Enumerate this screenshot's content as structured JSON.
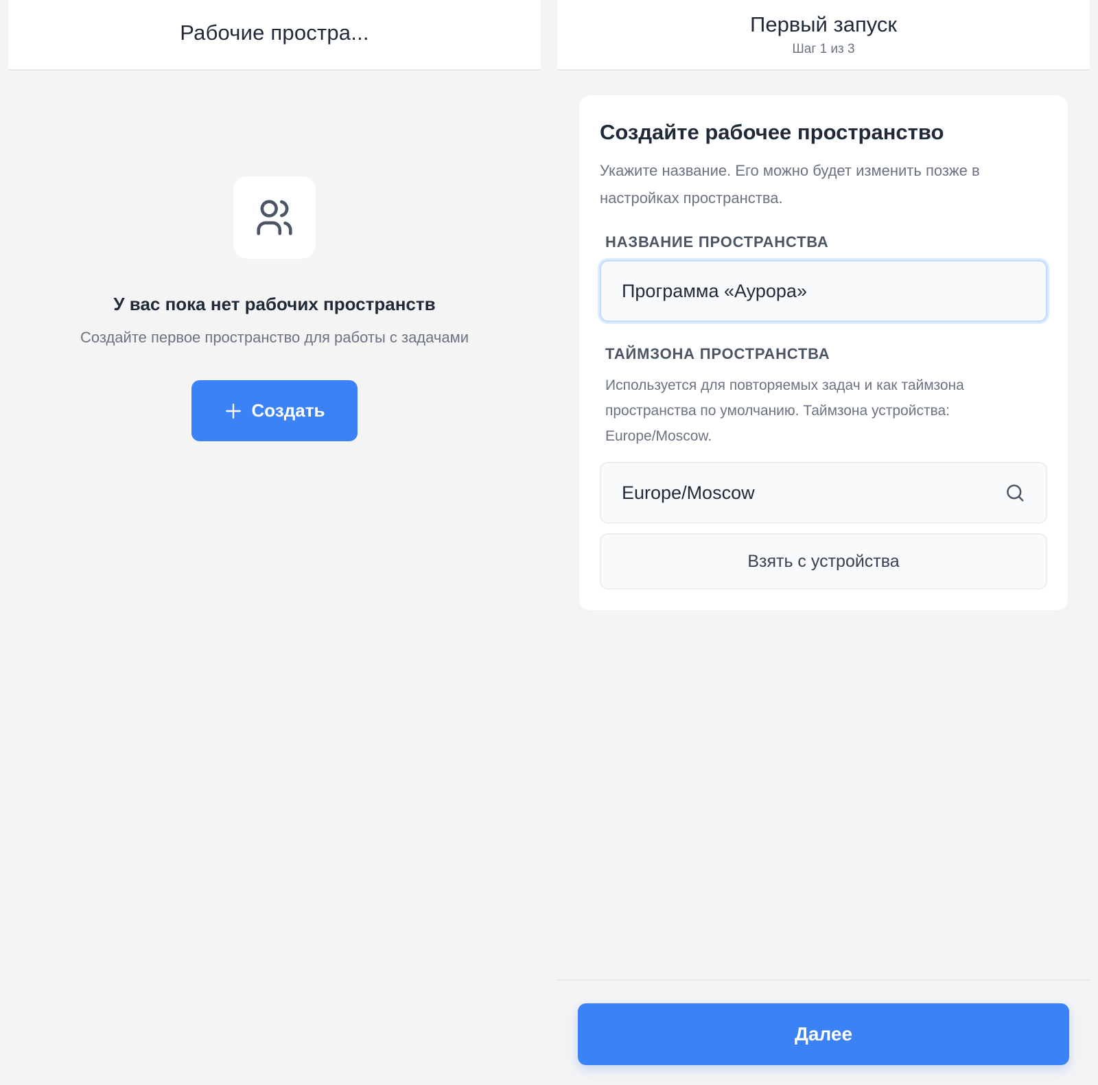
{
  "left_screen": {
    "header": {
      "title": "Рабочие простра..."
    },
    "empty_state": {
      "icon": "users-icon",
      "title": "У вас пока нет рабочих пространств",
      "subtitle": "Создайте первое пространство для работы с задачами",
      "create_button": {
        "icon": "plus-icon",
        "label": "Создать"
      }
    }
  },
  "right_screen": {
    "header": {
      "title": "Первый запуск",
      "subtitle": "Шаг 1 из 3"
    },
    "card": {
      "title": "Создайте рабочее пространство",
      "description": "Укажите название. Его можно будет изменить позже в настройках пространства.",
      "name_field": {
        "label": "НАЗВАНИЕ ПРОСТРАНСТВА",
        "value": "Программа «Аурора»"
      },
      "timezone_field": {
        "label": "ТАЙМЗОНА ПРОСТРАНСТВА",
        "description": "Используется для повторяемых задач и как таймзона пространства по умолчанию. Таймзона устройства: Europe/Moscow.",
        "value": "Europe/Moscow",
        "icon": "search-icon",
        "device_button_label": "Взять с устройства"
      }
    },
    "footer": {
      "next_button_label": "Далее"
    }
  },
  "colors": {
    "accent": "#3b82f6",
    "background": "#f4f4f5",
    "surface": "#ffffff",
    "text_primary": "#1f2937",
    "text_secondary": "#6b7280"
  }
}
